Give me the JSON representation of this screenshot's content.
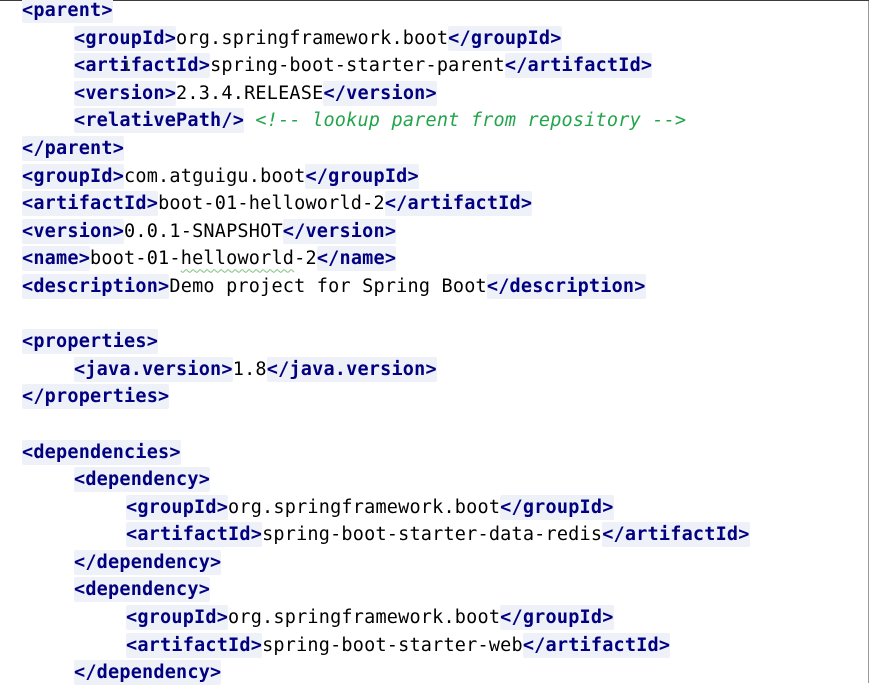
{
  "editor": {
    "lines": [
      {
        "indent": 0,
        "parts": [
          {
            "k": "tag",
            "t": "<parent>"
          }
        ]
      },
      {
        "indent": 1,
        "parts": [
          {
            "k": "tag",
            "t": "<groupId>"
          },
          {
            "k": "text",
            "t": "org.springframework.boot"
          },
          {
            "k": "tag",
            "t": "</groupId>"
          }
        ]
      },
      {
        "indent": 1,
        "parts": [
          {
            "k": "tag",
            "t": "<artifactId>"
          },
          {
            "k": "text",
            "t": "spring-boot-starter-parent"
          },
          {
            "k": "tag",
            "t": "</artifactId>"
          }
        ]
      },
      {
        "indent": 1,
        "parts": [
          {
            "k": "tag",
            "t": "<version>"
          },
          {
            "k": "text",
            "t": "2.3.4.RELEASE"
          },
          {
            "k": "tag",
            "t": "</version>"
          }
        ]
      },
      {
        "indent": 1,
        "parts": [
          {
            "k": "tag",
            "t": "<relativePath/>"
          },
          {
            "k": "text",
            "t": " "
          },
          {
            "k": "comment",
            "t": "<!-- lookup parent from repository -->"
          }
        ]
      },
      {
        "indent": 0,
        "parts": [
          {
            "k": "tag",
            "t": "</parent>"
          }
        ]
      },
      {
        "indent": 0,
        "parts": [
          {
            "k": "tag",
            "t": "<groupId>"
          },
          {
            "k": "text",
            "t": "com.atguigu.boot"
          },
          {
            "k": "tag",
            "t": "</groupId>"
          }
        ]
      },
      {
        "indent": 0,
        "parts": [
          {
            "k": "tag",
            "t": "<artifactId>"
          },
          {
            "k": "text",
            "t": "boot-01-helloworld-2"
          },
          {
            "k": "tag",
            "t": "</artifactId>"
          }
        ]
      },
      {
        "indent": 0,
        "parts": [
          {
            "k": "tag",
            "t": "<version>"
          },
          {
            "k": "text",
            "t": "0.0.1-SNAPSHOT"
          },
          {
            "k": "tag",
            "t": "</version>"
          }
        ]
      },
      {
        "indent": 0,
        "parts": [
          {
            "k": "tag",
            "t": "<name>"
          },
          {
            "k": "text",
            "t": "boot-01-"
          },
          {
            "k": "squiggle",
            "t": "helloworld"
          },
          {
            "k": "text",
            "t": "-2"
          },
          {
            "k": "tag",
            "t": "</name>"
          }
        ]
      },
      {
        "indent": 0,
        "parts": [
          {
            "k": "tag",
            "t": "<description>"
          },
          {
            "k": "text",
            "t": "Demo project for Spring Boot"
          },
          {
            "k": "tag",
            "t": "</description>"
          }
        ]
      },
      {
        "indent": 0,
        "parts": []
      },
      {
        "indent": 0,
        "parts": [
          {
            "k": "tag",
            "t": "<properties>"
          }
        ]
      },
      {
        "indent": 1,
        "parts": [
          {
            "k": "tag",
            "t": "<java.version>"
          },
          {
            "k": "text",
            "t": "1.8"
          },
          {
            "k": "tag",
            "t": "</java.version>"
          }
        ]
      },
      {
        "indent": 0,
        "parts": [
          {
            "k": "tag",
            "t": "</properties>"
          }
        ]
      },
      {
        "indent": 0,
        "parts": []
      },
      {
        "indent": 0,
        "parts": [
          {
            "k": "tag",
            "t": "<dependencies>"
          }
        ]
      },
      {
        "indent": 1,
        "parts": [
          {
            "k": "tag",
            "t": "<dependency>"
          }
        ]
      },
      {
        "indent": 2,
        "parts": [
          {
            "k": "tag",
            "t": "<groupId>"
          },
          {
            "k": "text",
            "t": "org.springframework.boot"
          },
          {
            "k": "tag",
            "t": "</groupId>"
          }
        ]
      },
      {
        "indent": 2,
        "parts": [
          {
            "k": "tag",
            "t": "<artifactId>"
          },
          {
            "k": "text",
            "t": "spring-boot-starter-data-redis"
          },
          {
            "k": "tag",
            "t": "</artifactId>"
          }
        ]
      },
      {
        "indent": 1,
        "parts": [
          {
            "k": "tag",
            "t": "</dependency>"
          }
        ]
      },
      {
        "indent": 1,
        "parts": [
          {
            "k": "tag",
            "t": "<dependency>"
          }
        ]
      },
      {
        "indent": 2,
        "parts": [
          {
            "k": "tag",
            "t": "<groupId>"
          },
          {
            "k": "text",
            "t": "org.springframework.boot"
          },
          {
            "k": "tag",
            "t": "</groupId>"
          }
        ]
      },
      {
        "indent": 2,
        "parts": [
          {
            "k": "tag",
            "t": "<artifactId>"
          },
          {
            "k": "text",
            "t": "spring-boot-starter-web"
          },
          {
            "k": "tag",
            "t": "</artifactId>"
          }
        ]
      },
      {
        "indent": 1,
        "parts": [
          {
            "k": "tag",
            "t": "</dependency>"
          }
        ]
      }
    ]
  },
  "colors": {
    "tag": "#000080",
    "text": "#000000",
    "comment": "#22a54a",
    "tag_background": "#eff1f8",
    "editor_background": "#ffffff"
  },
  "cursor": {
    "icon": "text-cursor-icon"
  }
}
